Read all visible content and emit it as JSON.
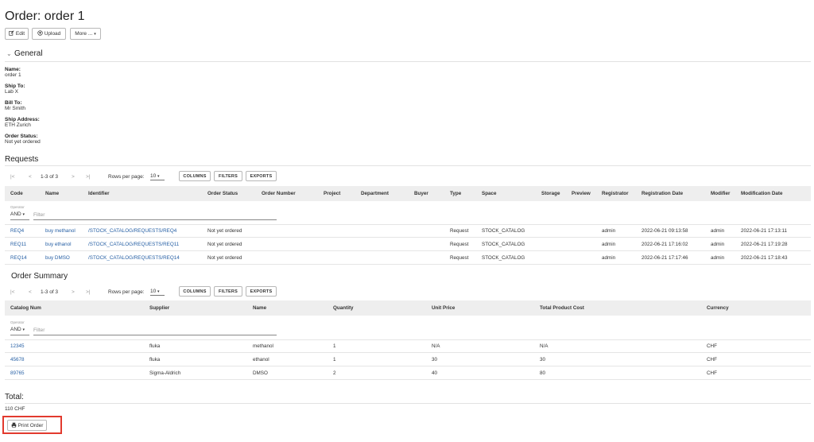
{
  "page": {
    "title": "Order: order 1"
  },
  "toolbar": {
    "edit_label": "Edit",
    "upload_label": "Upload",
    "more_label": "More ...",
    "edit_icon": "edit-icon",
    "upload_icon": "upload-icon",
    "more_icon": "caret-down-icon"
  },
  "general": {
    "title": "General",
    "fields": [
      {
        "label": "Name:",
        "value": "order 1"
      },
      {
        "label": "Ship To:",
        "value": "Lab X"
      },
      {
        "label": "Bill To:",
        "value": "Mr Smith"
      },
      {
        "label": "Ship Address:",
        "value": "ETH Zurich"
      },
      {
        "label": "Order Status:",
        "value": "Not yet ordered"
      }
    ]
  },
  "requests": {
    "title": "Requests",
    "pagination": {
      "first": "|<",
      "prev": "<",
      "count": "1-3 of 3",
      "next": ">",
      "last": ">|",
      "rows_label": "Rows per page:",
      "rows_value": "10"
    },
    "buttons": {
      "columns": "COLUMNS",
      "filters": "FILTERS",
      "exports": "EXPORTS"
    },
    "columns": [
      "Code",
      "Name",
      "Identifier",
      "Order Status",
      "Order Number",
      "Project",
      "Department",
      "Buyer",
      "Type",
      "Space",
      "Storage",
      "Preview",
      "Registrator",
      "Registration Date",
      "Modifier",
      "Modification Date"
    ],
    "filter": {
      "operator_label": "Operator",
      "operator_value": "AND",
      "placeholder": "Filter"
    },
    "rows": [
      {
        "code": "REQ4",
        "name": "buy methanol",
        "identifier": "/STOCK_CATALOG/REQUESTS/REQ4",
        "order_status": "Not yet ordered",
        "type": "Request",
        "space": "STOCK_CATALOG",
        "registrator": "admin",
        "registration_date": "2022-06-21 09:13:58",
        "modifier": "admin",
        "modification_date": "2022-06-21 17:13:11"
      },
      {
        "code": "REQ11",
        "name": "buy ethanol",
        "identifier": "/STOCK_CATALOG/REQUESTS/REQ11",
        "order_status": "Not yet ordered",
        "type": "Request",
        "space": "STOCK_CATALOG",
        "registrator": "admin",
        "registration_date": "2022-06-21 17:16:02",
        "modifier": "admin",
        "modification_date": "2022-06-21 17:19:28"
      },
      {
        "code": "REQ14",
        "name": "buy DMSO",
        "identifier": "/STOCK_CATALOG/REQUESTS/REQ14",
        "order_status": "Not yet ordered",
        "type": "Request",
        "space": "STOCK_CATALOG",
        "registrator": "admin",
        "registration_date": "2022-06-21 17:17:46",
        "modifier": "admin",
        "modification_date": "2022-06-21 17:18:43"
      }
    ]
  },
  "summary": {
    "title": "Order Summary",
    "pagination": {
      "first": "|<",
      "prev": "<",
      "count": "1-3 of 3",
      "next": ">",
      "last": ">|",
      "rows_label": "Rows per page:",
      "rows_value": "10"
    },
    "buttons": {
      "columns": "COLUMNS",
      "filters": "FILTERS",
      "exports": "EXPORTS"
    },
    "columns": [
      "Catalog Num",
      "Supplier",
      "Name",
      "Quantity",
      "Unit Price",
      "Total Product Cost",
      "Currency"
    ],
    "filter": {
      "operator_label": "Operator",
      "operator_value": "AND",
      "placeholder": "Filter"
    },
    "rows": [
      {
        "catalog_num": "12345",
        "supplier": "fluka",
        "name": "methanol",
        "quantity": "1",
        "unit_price": "N/A",
        "total": "N/A",
        "currency": "CHF"
      },
      {
        "catalog_num": "45678",
        "supplier": "fluka",
        "name": "ethanol",
        "quantity": "1",
        "unit_price": "30",
        "total": "30",
        "currency": "CHF"
      },
      {
        "catalog_num": "89765",
        "supplier": "Sigma-Aldrich",
        "name": "DMSO",
        "quantity": "2",
        "unit_price": "40",
        "total": "80",
        "currency": "CHF"
      }
    ]
  },
  "total": {
    "title": "Total:",
    "value": "110 CHF"
  },
  "print": {
    "label": "Print Order",
    "icon": "printer-icon"
  },
  "colors": {
    "link": "#2760a5",
    "header_bg": "#eeeeee",
    "highlight": "#e23a2e"
  }
}
